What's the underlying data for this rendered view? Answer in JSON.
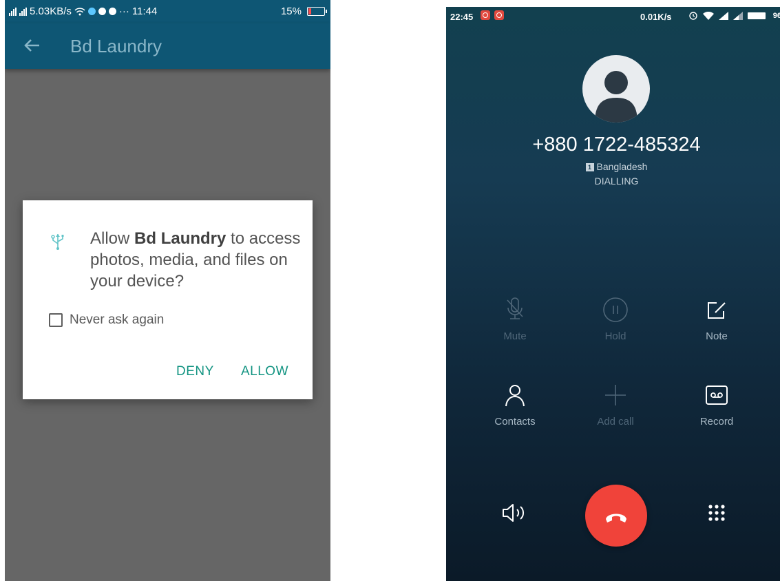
{
  "left_screen": {
    "status_bar": {
      "speed": "5.03KB/s",
      "time": "11:44",
      "battery": "15%"
    },
    "app_bar": {
      "title": "Bd Laundry",
      "back_icon": "back-arrow-icon"
    },
    "permission_dialog": {
      "icon": "usb-icon",
      "message_prefix": "Allow ",
      "app_name": "Bd Laundry",
      "message_suffix": " to access photos, media, and files on your device?",
      "checkbox_label": "Never ask again",
      "checkbox_checked": false,
      "deny_label": "DENY",
      "allow_label": "ALLOW",
      "accent_color": "#139482"
    }
  },
  "right_screen": {
    "status_bar": {
      "time": "22:45",
      "speed": "0.01K/s",
      "battery": "96"
    },
    "call": {
      "number": "+880 1722-485324",
      "sim_label": "1",
      "country": "Bangladesh",
      "status": "DIALLING"
    },
    "controls": [
      {
        "label": "Mute",
        "icon": "mute-icon",
        "enabled": false
      },
      {
        "label": "Hold",
        "icon": "hold-icon",
        "enabled": false
      },
      {
        "label": "Note",
        "icon": "note-icon",
        "enabled": true
      },
      {
        "label": "Contacts",
        "icon": "contacts-icon",
        "enabled": true
      },
      {
        "label": "Add call",
        "icon": "add-call-icon",
        "enabled": false
      },
      {
        "label": "Record",
        "icon": "record-icon",
        "enabled": true
      }
    ],
    "bottom_bar": {
      "speaker_icon": "speaker-icon",
      "end_call_icon": "end-call-icon",
      "dialpad_icon": "dialpad-icon",
      "end_call_color": "#f0433a"
    }
  }
}
